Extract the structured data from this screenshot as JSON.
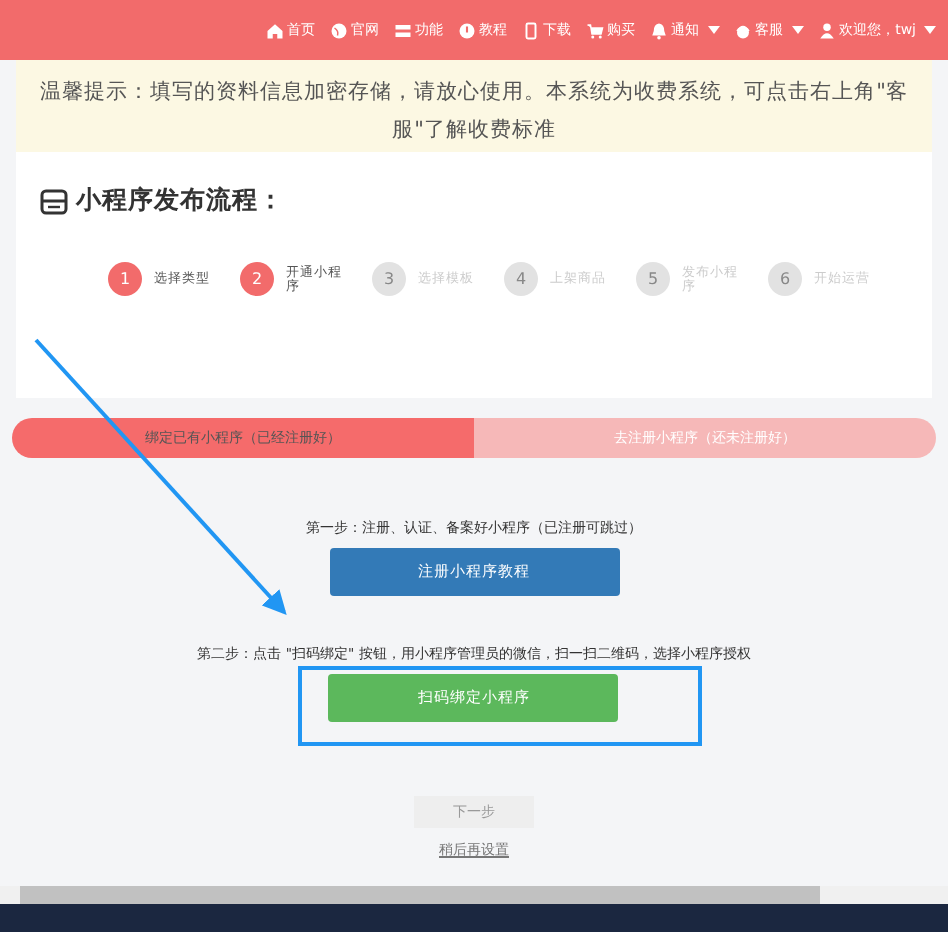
{
  "nav": {
    "items": [
      {
        "label": "首页",
        "dropdown": false
      },
      {
        "label": "官网",
        "dropdown": false
      },
      {
        "label": "功能",
        "dropdown": false
      },
      {
        "label": "教程",
        "dropdown": false
      },
      {
        "label": "下载",
        "dropdown": false
      },
      {
        "label": "购买",
        "dropdown": false
      },
      {
        "label": "通知",
        "dropdown": true
      },
      {
        "label": "客服",
        "dropdown": true
      },
      {
        "label": "欢迎您，twj",
        "dropdown": true
      }
    ]
  },
  "notice": "温馨提示：填写的资料信息加密存储，请放心使用。本系统为收费系统，可点击右上角\"客服\"了解收费标准",
  "process": {
    "title": "小程序发布流程：",
    "steps": [
      {
        "number": "1",
        "label": "选择类型",
        "active": true
      },
      {
        "number": "2",
        "label": "开通小程序",
        "active": true
      },
      {
        "number": "3",
        "label": "选择模板",
        "active": false
      },
      {
        "number": "4",
        "label": "上架商品",
        "active": false
      },
      {
        "number": "5",
        "label": "发布小程序",
        "active": false
      },
      {
        "number": "6",
        "label": "开始运营",
        "active": false
      }
    ]
  },
  "tabs": [
    {
      "label": "绑定已有小程序（已经注册好）",
      "selected": true
    },
    {
      "label": "去注册小程序（还未注册好）",
      "selected": false
    }
  ],
  "step_one": {
    "text": "第一步：注册、认证、备案好小程序（已注册可跳过）",
    "button": "注册小程序教程"
  },
  "step_two": {
    "text": "第二步：点击 \"扫码绑定\" 按钮，用小程序管理员的微信，扫一扫二维码，选择小程序授权",
    "button": "扫码绑定小程序"
  },
  "next_button": {
    "label": "下一步",
    "disabled": true
  },
  "later_link": "稍后再设置"
}
